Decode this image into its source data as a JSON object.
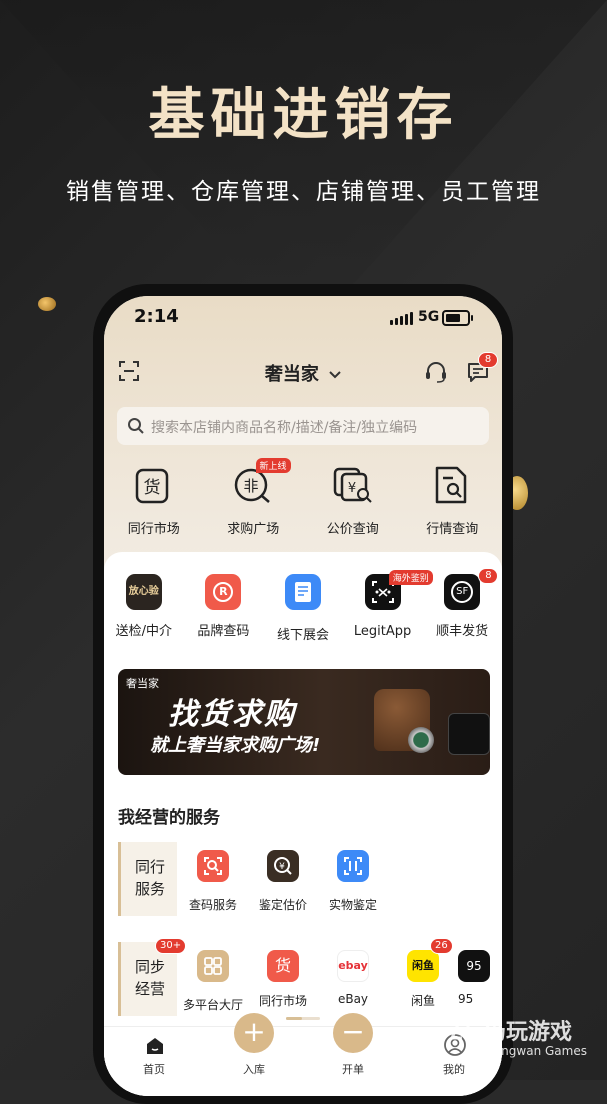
{
  "promo": {
    "title": "基础进销存",
    "subtitle": "销售管理、仓库管理、店铺管理、员工管理"
  },
  "status_bar": {
    "time": "2:14",
    "network": "5G"
  },
  "header": {
    "store_name": "奢当家",
    "message_badge": "8"
  },
  "search": {
    "placeholder": "搜索本店铺内商品名称/描述/备注/独立编码"
  },
  "quick_actions": [
    {
      "label": "同行市场",
      "icon": "goods-icon"
    },
    {
      "label": "求购广场",
      "icon": "wanted-icon",
      "tag": "新上线"
    },
    {
      "label": "公价查询",
      "icon": "price-search-icon"
    },
    {
      "label": "行情查询",
      "icon": "market-doc-icon"
    }
  ],
  "services": [
    {
      "label": "送检/中介",
      "icon": "inspection-icon",
      "icon_text": "放心验"
    },
    {
      "label": "品牌查码",
      "icon": "brand-code-icon",
      "icon_text": "R"
    },
    {
      "label": "线下展会",
      "icon": "expo-icon"
    },
    {
      "label": "LegitApp",
      "icon": "legitapp-icon",
      "tag": "海外鉴别"
    },
    {
      "label": "顺丰发货",
      "icon": "sf-express-icon",
      "icon_text": "SF",
      "badge": "8"
    }
  ],
  "banner": {
    "brand": "奢当家",
    "headline": "找货求购",
    "subline": "就上奢当家求购广场!"
  },
  "section_title": "我经营的服务",
  "groups": [
    {
      "name": "同行\n服务",
      "items": [
        {
          "label": "查码服务",
          "icon": "code-scan-icon"
        },
        {
          "label": "鉴定估价",
          "icon": "appraisal-icon"
        },
        {
          "label": "实物鉴定",
          "icon": "physical-auth-icon"
        }
      ]
    },
    {
      "name": "同步\n经营",
      "badge": "30+",
      "items": [
        {
          "label": "多平台大厅",
          "icon": "multi-platform-icon"
        },
        {
          "label": "同行市场",
          "icon": "goods-icon",
          "icon_text": "货"
        },
        {
          "label": "eBay",
          "icon": "ebay-icon",
          "icon_text": "ebay"
        },
        {
          "label": "闲鱼",
          "icon": "xianyu-icon",
          "icon_text": "闲鱼",
          "badge": "26"
        },
        {
          "label": "95",
          "icon": "platform-95-icon",
          "icon_text": "95"
        }
      ]
    }
  ],
  "tabbar": [
    {
      "label": "首页",
      "icon": "home-icon"
    },
    {
      "label": "入库",
      "icon": "plus-icon"
    },
    {
      "label": "开单",
      "icon": "minus-icon"
    },
    {
      "label": "我的",
      "icon": "profile-icon"
    }
  ],
  "watermark": {
    "name": "仍玩游戏",
    "latin": "Rengwan Games"
  },
  "colors": {
    "accent": "#d9b98a",
    "badge": "#e33b2f",
    "title_gold": "#f3e2c6"
  }
}
